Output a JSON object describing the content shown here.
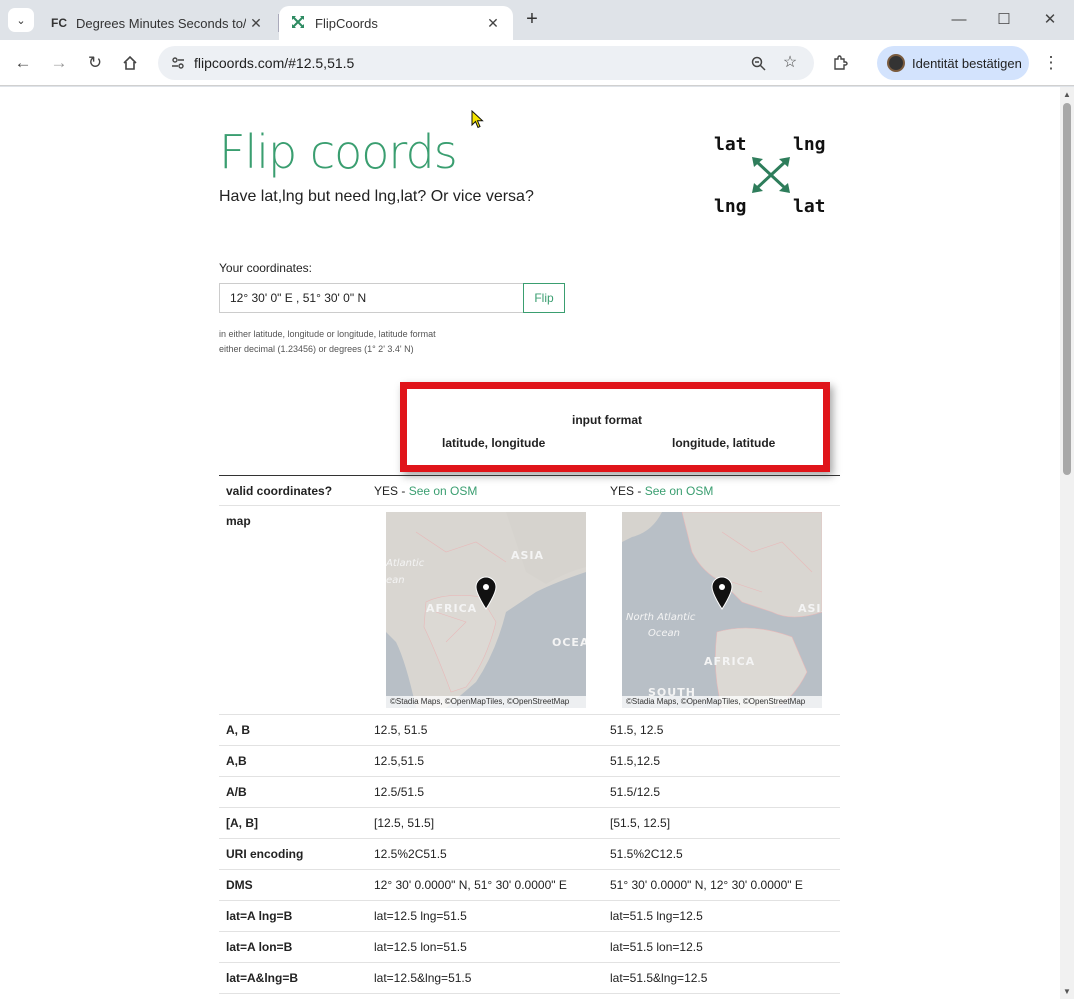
{
  "browser": {
    "tabs": [
      {
        "favicon": "FC",
        "title": "Degrees Minutes Seconds to/from Decimal",
        "active": false
      },
      {
        "favicon": "flip-arrows-icon",
        "title": "FlipCoords",
        "active": true
      }
    ],
    "url": "flipcoords.com/#12.5,51.5",
    "profile_label": "Identität bestätigen"
  },
  "page": {
    "title": "Flip coords",
    "tagline": "Have lat,lng but need lng,lat? Or vice versa?",
    "logo": {
      "top_left": "lat",
      "top_right": "lng",
      "bottom_left": "lng",
      "bottom_right": "lat"
    },
    "input_label": "Your coordinates:",
    "input_value": "12° 30' 0\" E , 51° 30' 0\" N",
    "flip_label": "Flip",
    "hint_line1": "in either latitude, longitude or longitude, latitude format",
    "hint_line2": "either decimal (1.23456) or degrees (1° 2' 3.4' N)"
  },
  "table": {
    "header": {
      "title": "input format",
      "col1": "latitude, longitude",
      "col2": "longitude, latitude"
    },
    "valid": {
      "label": "valid coordinates?",
      "col1": "YES - ",
      "col2": "YES - ",
      "link": "See on OSM"
    },
    "map": {
      "label": "map",
      "credit": "©Stadia Maps, ©OpenMapTiles, ©OpenStreetMap",
      "map1_labels": [
        "Atlantic",
        "ean",
        "ASIA",
        "AFRICA",
        "OCEA"
      ],
      "map2_labels": [
        "North Atlantic",
        "Ocean",
        "ASIA",
        "AFRICA",
        "SOUTH"
      ]
    },
    "rows": [
      {
        "label": "A, B",
        "col1": "12.5, 51.5",
        "col2": "51.5, 12.5"
      },
      {
        "label": "A,B",
        "col1": "12.5,51.5",
        "col2": "51.5,12.5"
      },
      {
        "label": "A/B",
        "col1": "12.5/51.5",
        "col2": "51.5/12.5"
      },
      {
        "label": "[A, B]",
        "col1": "[12.5, 51.5]",
        "col2": "[51.5, 12.5]"
      },
      {
        "label": "URI encoding",
        "col1": "12.5%2C51.5",
        "col2": "51.5%2C12.5"
      },
      {
        "label": "DMS",
        "col1": "12° 30' 0.0000\" N, 51° 30' 0.0000\" E",
        "col2": "51° 30' 0.0000\" N, 12° 30' 0.0000\" E"
      },
      {
        "label": "lat=A lng=B",
        "col1": "lat=12.5 lng=51.5",
        "col2": "lat=51.5 lng=12.5"
      },
      {
        "label": "lat=A lon=B",
        "col1": "lat=12.5 lon=51.5",
        "col2": "lat=51.5 lon=12.5"
      },
      {
        "label": "lat=A&lng=B",
        "col1": "lat=12.5&lng=51.5",
        "col2": "lat=51.5&lng=12.5"
      }
    ]
  },
  "colors": {
    "accent": "#3a9e70",
    "highlight": "#e0141a"
  }
}
